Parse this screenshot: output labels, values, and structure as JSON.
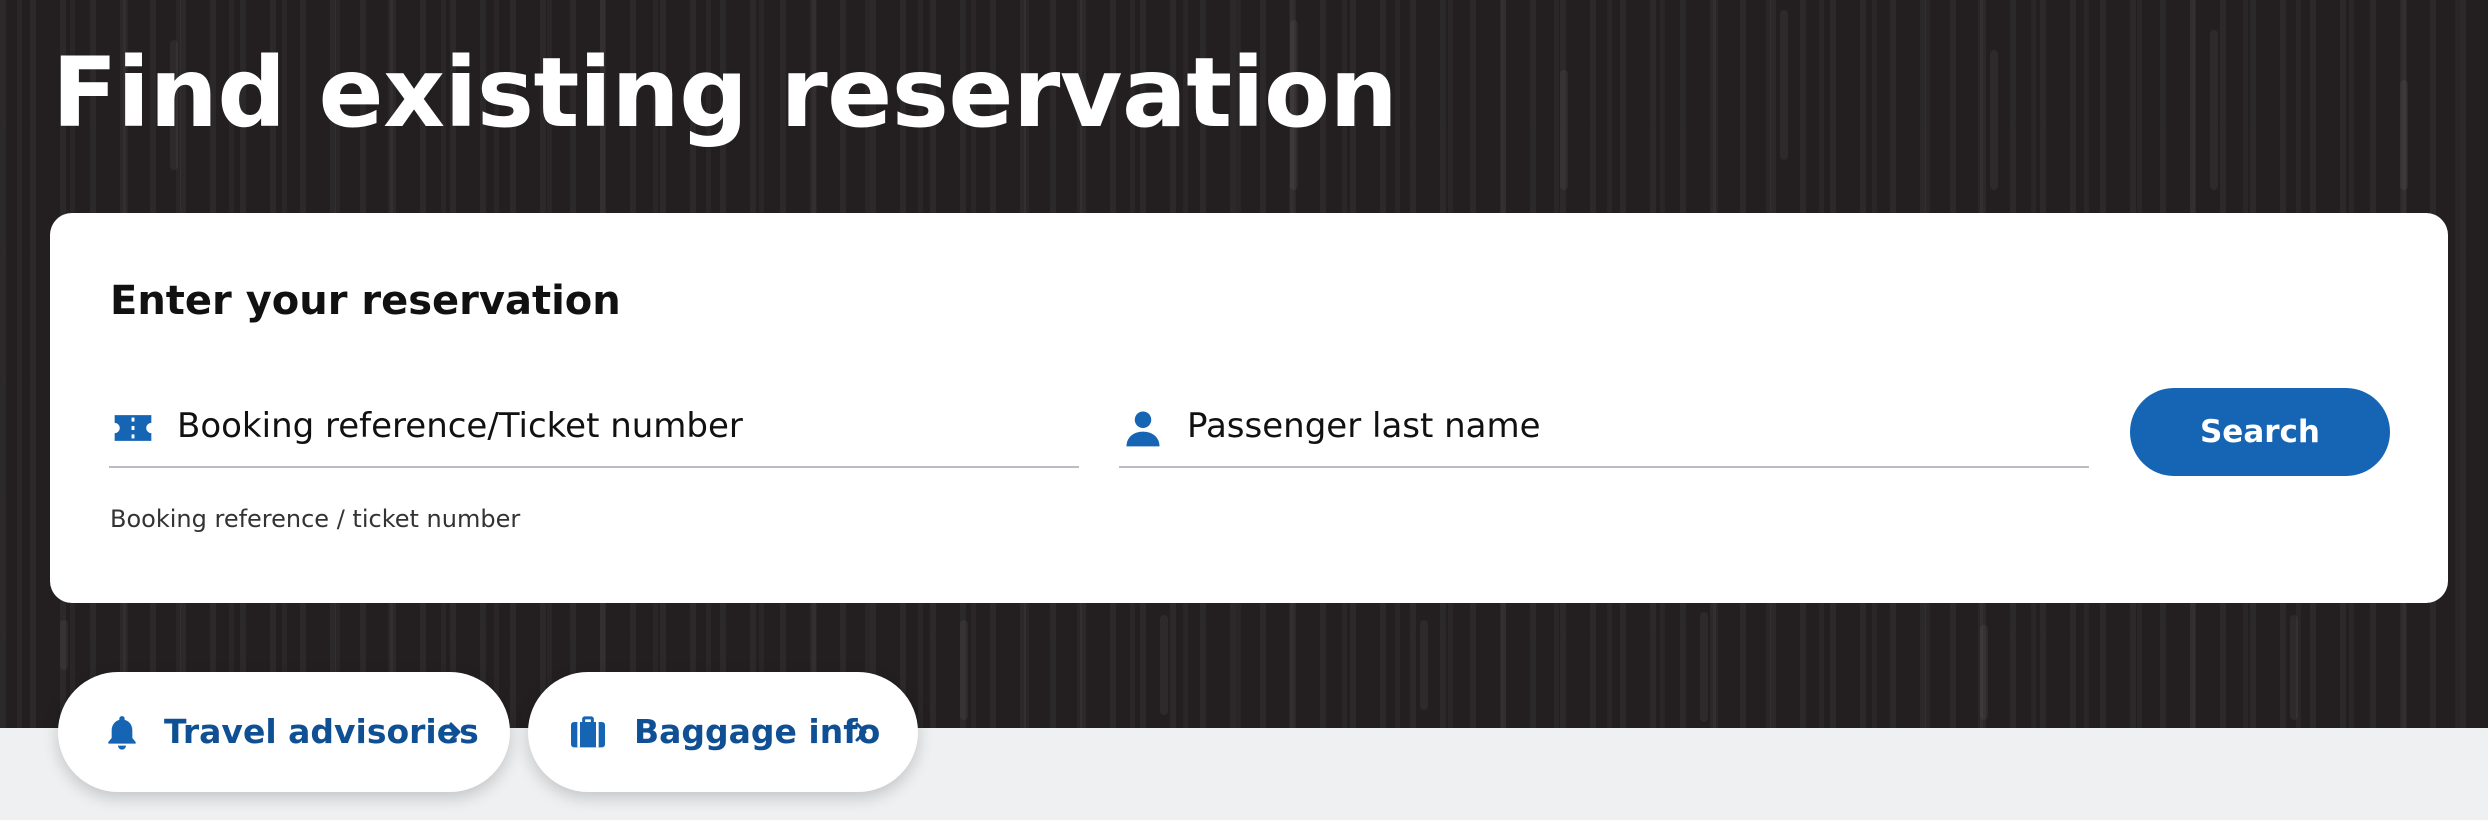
{
  "page": {
    "title": "Find existing reservation"
  },
  "reservation_form": {
    "heading": "Enter your reservation",
    "booking_field": {
      "icon": "ticket-icon",
      "placeholder": "Booking reference/Ticket number",
      "value": "",
      "helper": "Booking reference / ticket number"
    },
    "lastname_field": {
      "icon": "person-icon",
      "placeholder": "Passenger last name",
      "value": ""
    },
    "search_label": "Search"
  },
  "quick_links": [
    {
      "label": "Travel advisories",
      "icon": "bell-icon"
    },
    {
      "label": "Baggage info",
      "icon": "suitcase-icon"
    }
  ],
  "colors": {
    "hero_background": "#231f20",
    "page_background": "#eef0f2",
    "accent": "#1565b4",
    "link_text": "#0f4f94"
  }
}
